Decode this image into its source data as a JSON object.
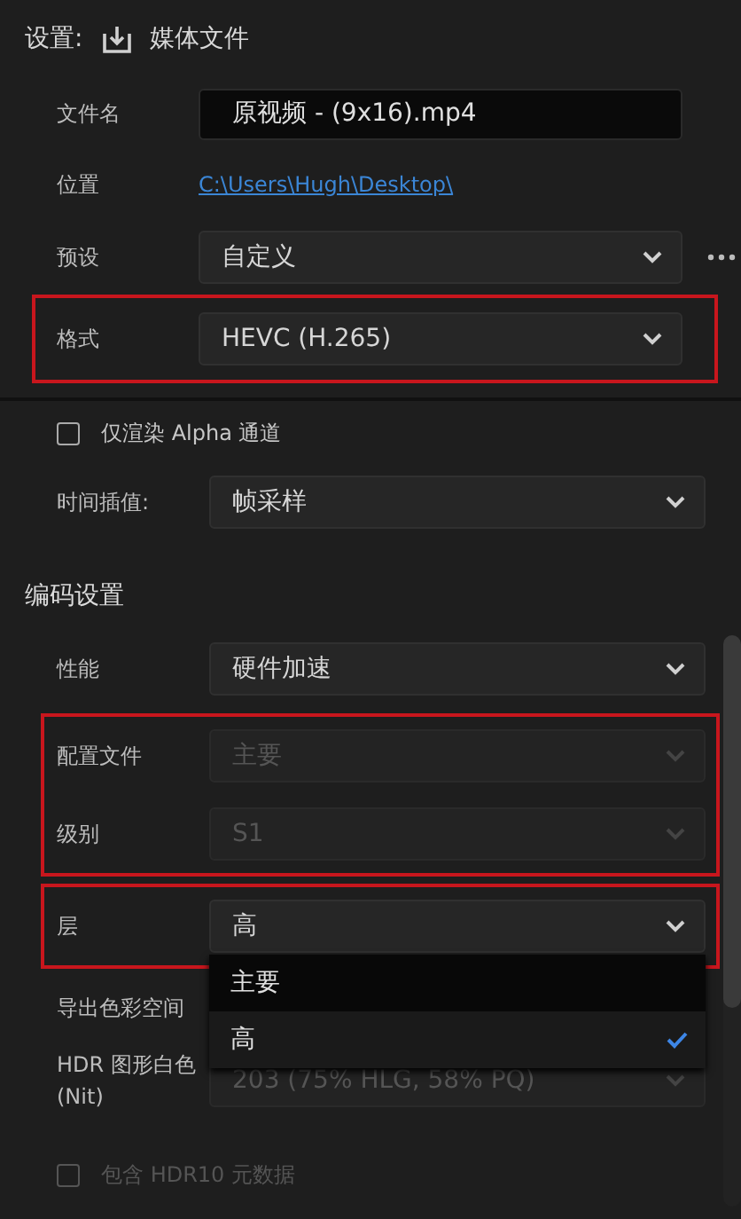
{
  "header": {
    "label": "设置:",
    "title": "媒体文件"
  },
  "file_name": {
    "label": "文件名",
    "value": "原视频 - (9x16).mp4"
  },
  "location": {
    "label": "位置",
    "link": "C:\\Users\\Hugh\\Desktop\\"
  },
  "preset": {
    "label": "预设",
    "value": "自定义"
  },
  "format": {
    "label": "格式",
    "value": "HEVC (H.265)",
    "highlighted": true
  },
  "alpha_only": {
    "label": "仅渲染 Alpha 通道",
    "checked": false,
    "disabled": false
  },
  "time_interpolation": {
    "label": "时间插值:",
    "value": "帧采样"
  },
  "encoding": {
    "title": "编码设置",
    "groups": [
      {
        "highlighted": false,
        "rows": [
          {
            "kind": "select",
            "label": "性能",
            "value": "硬件加速",
            "disabled": false
          }
        ]
      },
      {
        "highlighted": true,
        "rows": [
          {
            "kind": "select",
            "label": "配置文件",
            "value": "主要",
            "disabled": true
          },
          {
            "kind": "select",
            "label": "级别",
            "value": "S1",
            "disabled": true
          }
        ]
      },
      {
        "highlighted": true,
        "rows": [
          {
            "kind": "select",
            "label": "层",
            "value": "高",
            "disabled": false,
            "expanded": true,
            "options": [
              {
                "label": "主要",
                "selected": false,
                "hovered": true
              },
              {
                "label": "高",
                "selected": true,
                "hovered": false
              }
            ]
          }
        ]
      },
      {
        "highlighted": false,
        "rows": [
          {
            "kind": "label",
            "label": "导出色彩空间"
          },
          {
            "kind": "select",
            "label": "HDR 图形白色 (Nit)",
            "value": "203 (75% HLG, 58% PQ)",
            "disabled": true
          },
          {
            "kind": "checkbox",
            "label": "包含 HDR10 元数据",
            "checked": false,
            "disabled": true
          }
        ]
      }
    ]
  }
}
